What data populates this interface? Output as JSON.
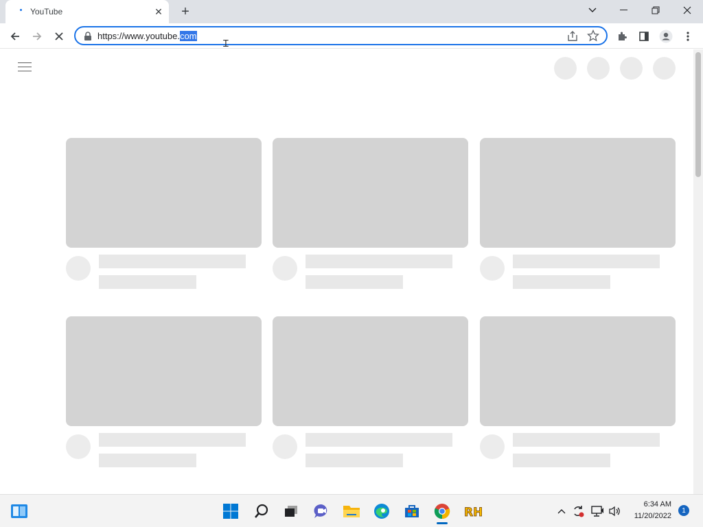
{
  "browser": {
    "tab_title": "YouTube",
    "url_prefix": "https://www.youtube.",
    "url_selected": "com",
    "new_tab_symbol": "+",
    "close_symbol": "✕"
  },
  "window_controls": {
    "dropdown": "⌄",
    "minimize": "—",
    "restore": "❐",
    "close": "✕"
  },
  "colors": {
    "accent": "#1a73e8",
    "placeholder_thumb": "#d3d3d3",
    "placeholder_line": "#e8e8e8",
    "tabstrip": "#dee1e6",
    "taskbar": "#f3f3f3"
  },
  "page": {
    "loading": true,
    "placeholder_cards": 6
  },
  "taskbar": {
    "icons": [
      "widgets-icon",
      "start-icon",
      "search-icon",
      "task-view-icon",
      "teams-chat-icon",
      "file-explorer-icon",
      "edge-icon",
      "store-icon",
      "chrome-icon",
      "rh-app-icon"
    ],
    "time": "6:34 AM",
    "date": "11/20/2022",
    "notification_count": "1"
  }
}
